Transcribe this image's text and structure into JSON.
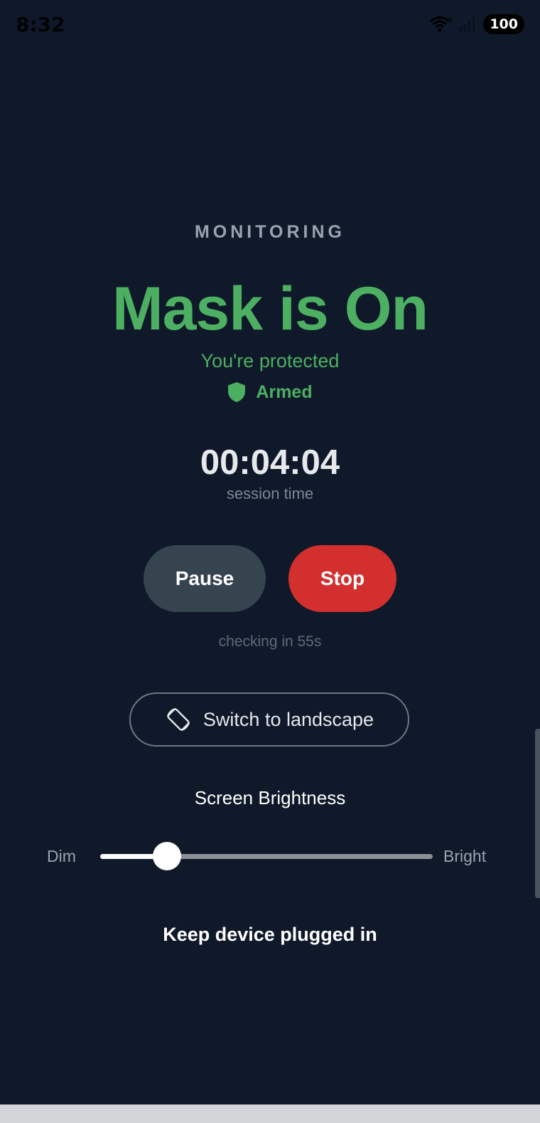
{
  "status_bar": {
    "time": "8:32",
    "network": "5",
    "battery": "100"
  },
  "monitoring": {
    "label": "MONITORING",
    "title": "Mask is On",
    "subtitle": "You're protected",
    "armed_label": "Armed"
  },
  "session": {
    "time": "00:04:04",
    "label": "session time"
  },
  "actions": {
    "pause_label": "Pause",
    "stop_label": "Stop"
  },
  "checking_text": "checking in 55s",
  "orientation": {
    "label": "Switch to landscape",
    "icon": "screen-rotation-icon"
  },
  "brightness": {
    "title": "Screen Brightness",
    "min_label": "Dim",
    "max_label": "Bright",
    "level": 0.2
  },
  "footer_note": "Keep device plugged in",
  "colors": {
    "background": "#0f1929",
    "accent_green": "#4caf62",
    "stop_red": "#d32f2f",
    "pause_gray": "#36444f"
  }
}
